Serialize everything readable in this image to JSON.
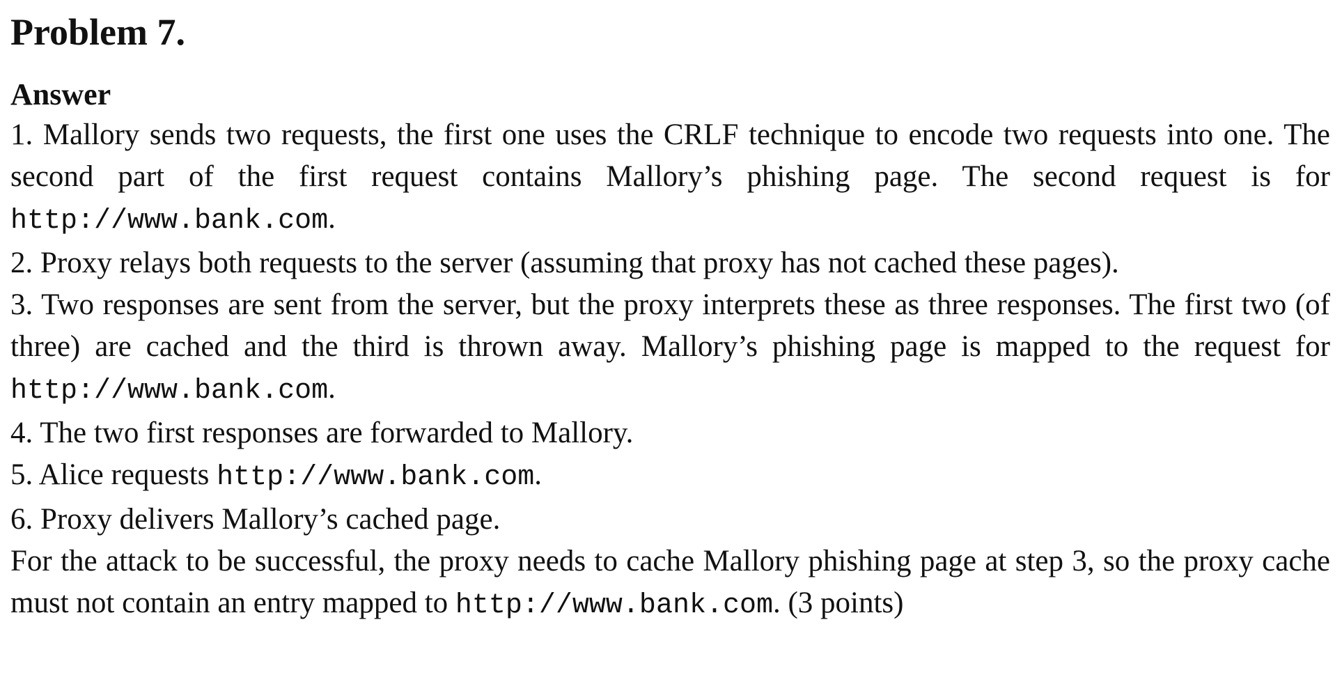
{
  "problem": {
    "title": "Problem 7."
  },
  "answer": {
    "heading": "Answer",
    "url": "http://www.bank.com",
    "steps": [
      {
        "before": "1.  Mallory sends two requests, the first one uses the CRLF technique to encode two requests into one. The second part of the first request contains Mallory’s phishing page. The second request is for ",
        "after": "."
      },
      {
        "text": "2.  Proxy relays both requests to the server (assuming that proxy has not cached these pages)."
      },
      {
        "before": "3.  Two responses are sent from the server, but the proxy interprets these as three responses.  The first two (of three) are cached and the third is thrown away.  Mallory’s phishing page is mapped to the request for ",
        "after": "."
      },
      {
        "text": "4.  The two first responses are forwarded to Mallory."
      },
      {
        "before": "5.  Alice requests ",
        "after": "."
      },
      {
        "text": "6.  Proxy delivers Mallory’s cached page."
      }
    ],
    "conclusion": {
      "before": "For the attack to be successful, the proxy needs to cache Mallory phishing page at step 3, so the proxy cache must not contain an entry mapped to ",
      "after": ". (3 points)"
    }
  }
}
